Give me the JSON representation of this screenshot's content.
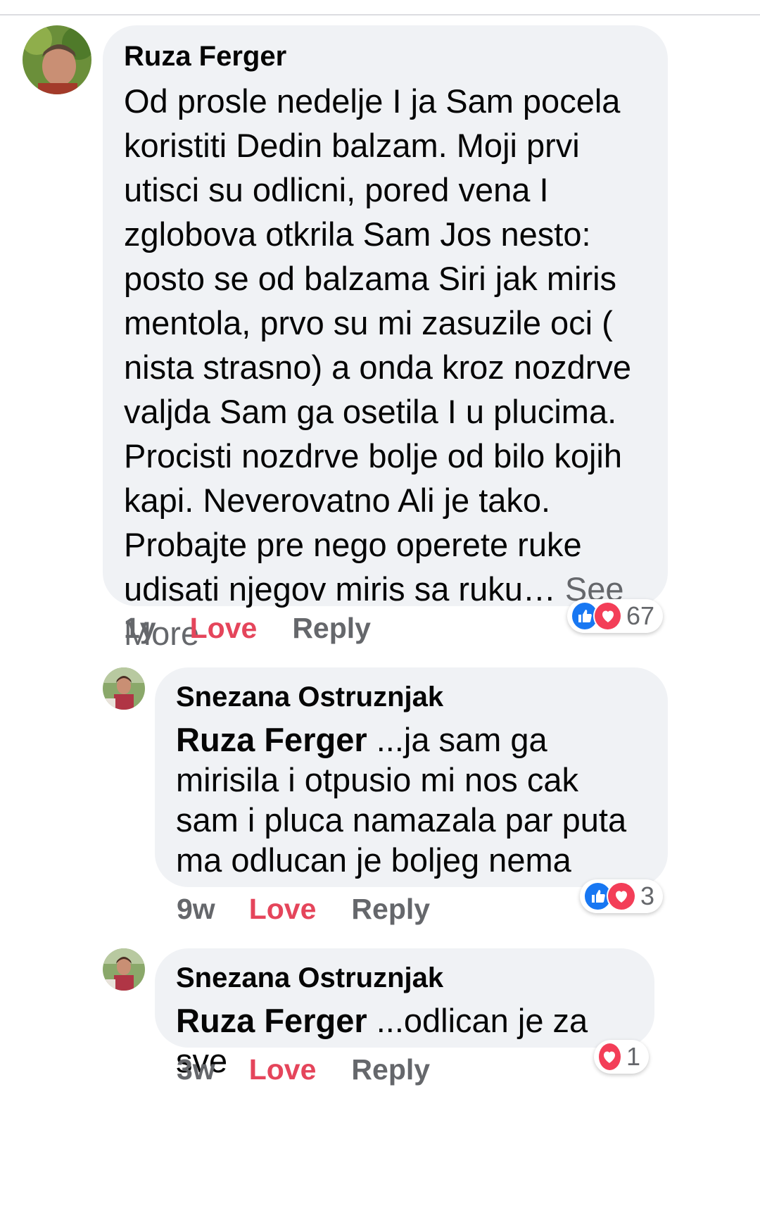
{
  "comments": [
    {
      "author": "Ruza Ferger",
      "text": "Od prosle nedelje I ja Sam pocela koristiti Dedin balzam. Moji prvi utisci su odlicni, pored vena I zglobova otkrila Sam Jos nesto: posto se od balzama Siri jak miris mentola, prvo su mi zasuzile oci ( nista strasno) a onda kroz nozdrve valjda Sam ga osetila I u plucima. Procisti nozdrve bolje od bilo kojih kapi. Neverovatno Ali je tako. Probajte pre nego operete ruke udisati njegov miris sa ruku…",
      "see_more": "See More",
      "time": "1y",
      "love": "Love",
      "reply": "Reply",
      "reaction_count": "67",
      "reaction_icons": [
        "like-icon",
        "love-icon"
      ]
    },
    {
      "author": "Snezana Ostruznjak",
      "mention": "Ruza Ferger",
      "text": "...ja sam ga mirisila i otpusio mi nos cak sam i pluca namazala par puta ma odlucan je boljeg nema",
      "time": "9w",
      "love": "Love",
      "reply": "Reply",
      "reaction_count": "3",
      "reaction_icons": [
        "like-icon",
        "love-icon"
      ]
    },
    {
      "author": "Snezana Ostruznjak",
      "mention": "Ruza Ferger",
      "text": "...odlican je za sve",
      "time": "3w",
      "love": "Love",
      "reply": "Reply",
      "reaction_count": "1",
      "reaction_icons": [
        "love-icon"
      ]
    }
  ],
  "colors": {
    "bubble": "#f0f2f5",
    "love_text": "#e5455b",
    "secondary_text": "#65676b",
    "like_blue": "#1877f2",
    "love_red": "#f33e58"
  }
}
